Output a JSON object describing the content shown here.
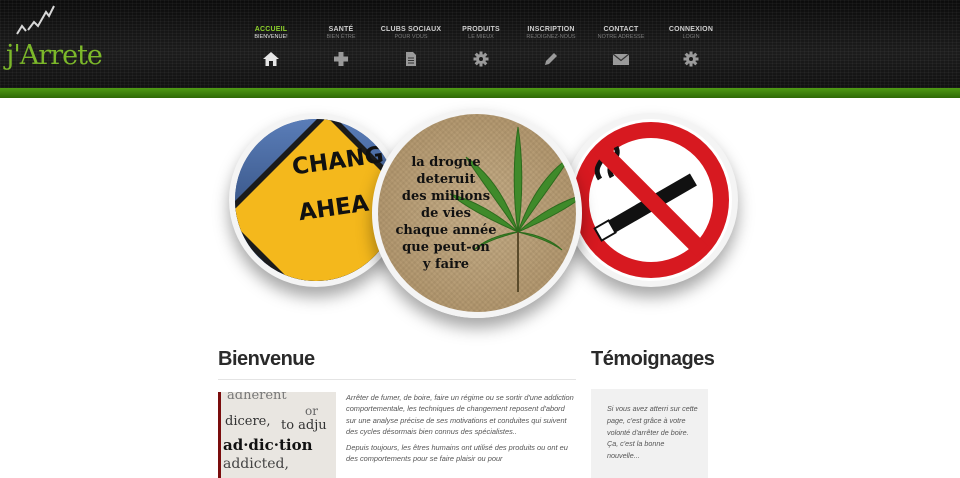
{
  "logo": {
    "text": "j'Arrete"
  },
  "nav": [
    {
      "title": "Accueil",
      "sub": "Bienvenue!",
      "icon": "home-icon",
      "active": true
    },
    {
      "title": "Santé",
      "sub": "Bien être",
      "icon": "plus-icon"
    },
    {
      "title": "Clubs sociaux",
      "sub": "Pour vous",
      "icon": "document-icon"
    },
    {
      "title": "Produits",
      "sub": "Le mieux",
      "icon": "gear-icon"
    },
    {
      "title": "Inscription",
      "sub": "Rejoignez-nous",
      "icon": "pencil-icon"
    },
    {
      "title": "Contact",
      "sub": "Notre adresse",
      "icon": "envelope-icon"
    },
    {
      "title": "Connexion",
      "sub": "Login",
      "icon": "gear-icon"
    }
  ],
  "hero": {
    "left": {
      "lines": [
        "CHANGE",
        "AHEA"
      ]
    },
    "center": {
      "lines": [
        "la drogue",
        "deteruit",
        "des millions",
        "de vies",
        "chaque année",
        "que peut-on",
        "y faire"
      ]
    }
  },
  "main": {
    "title": "Bienvenue",
    "image_words": [
      "adherent",
      "or",
      "dicere,",
      "to adju",
      "ad·dic·tion",
      "addicted,"
    ],
    "paragraphs": [
      "Arrêter de fumer, de boire, faire un régime ou se sortir d'une addiction comportementale, les techniques de changement reposent d'abord sur une analyse précise de ses motivations et conduites qui suivent des cycles désormais bien connus des spécialistes..",
      "Depuis toujours, les êtres humains ont utilisé des produits ou ont eu des comportements pour se faire plaisir ou pour"
    ]
  },
  "side": {
    "title": "Témoignages",
    "text": "Si vous avez atterri sur cette page, c'est grâce à votre volonté d'arrêter de boire. Ça, c'est la bonne nouvelle..."
  },
  "colors": {
    "green": "#3a7d0c",
    "nav_active": "#8ccf2c"
  }
}
